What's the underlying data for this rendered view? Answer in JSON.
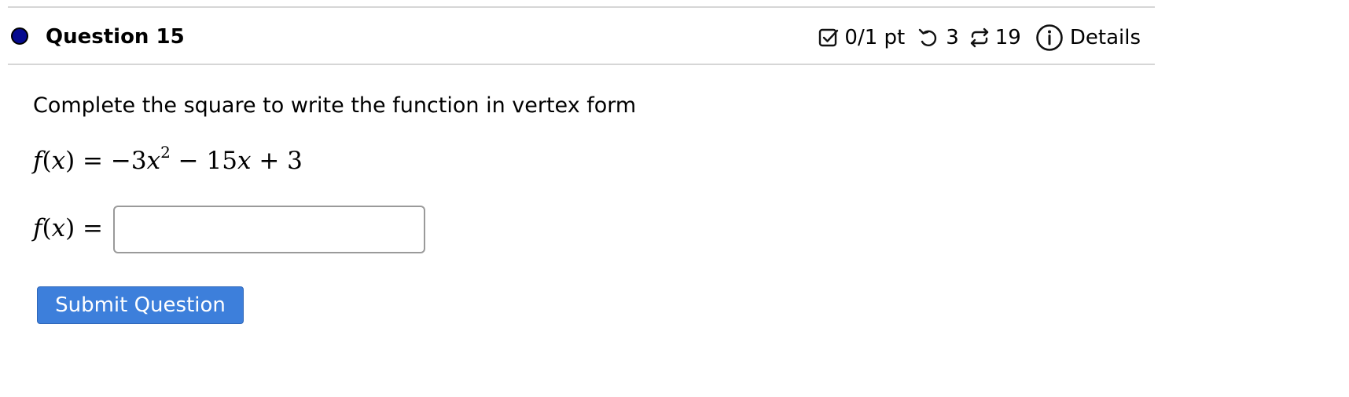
{
  "question": {
    "title": "Question 15",
    "score": "0/1 pt",
    "retries": "3",
    "attempts": "19",
    "details_label": "Details",
    "status_color": "#050a8f"
  },
  "icons": {
    "score": "checkbox-icon",
    "retries": "retry-icon",
    "attempts": "attempts-icon",
    "details": "info-icon"
  },
  "prompt": "Complete the square to write the function in vertex form",
  "equation": {
    "lhs_fn": "f",
    "lhs_var": "x",
    "equals": "=",
    "minus_sign": "−",
    "coef_a": "3",
    "var1": "x",
    "exponent": "2",
    "op1": "−",
    "coef_b": "15",
    "var2": "x",
    "op2": "+",
    "constant": "3"
  },
  "answer": {
    "lhs_fn": "f",
    "lhs_var": "x",
    "equals": "=",
    "value": "",
    "placeholder": ""
  },
  "submit_label": "Submit Question",
  "colors": {
    "accent": "#3d7fdb",
    "divider": "#d6d6d6"
  }
}
